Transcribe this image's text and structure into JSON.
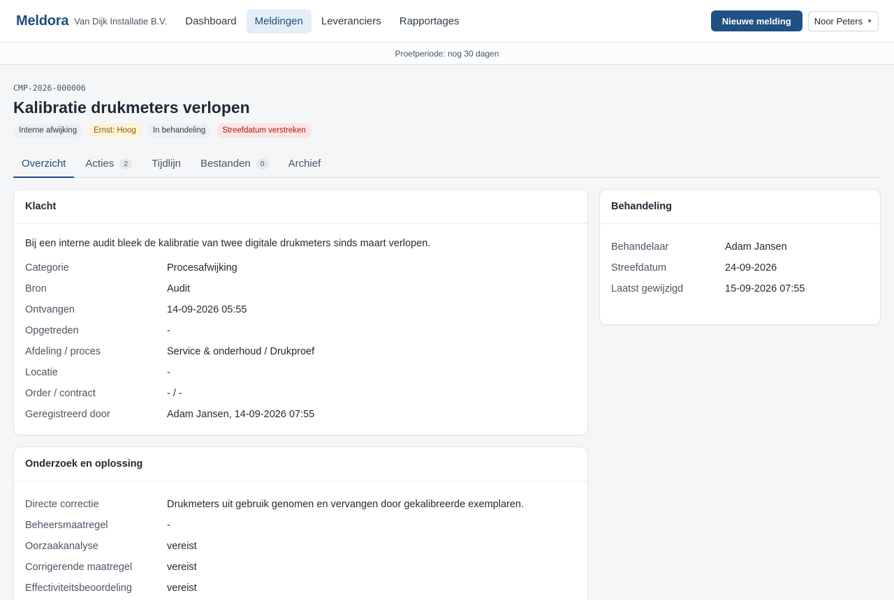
{
  "header": {
    "brand": "Meldora",
    "company": "Van Dijk Installatie B.V.",
    "nav": [
      {
        "label": "Dashboard",
        "active": false
      },
      {
        "label": "Meldingen",
        "active": true
      },
      {
        "label": "Leveranciers",
        "active": false
      },
      {
        "label": "Rapportages",
        "active": false
      }
    ],
    "new_button": "Nieuwe melding",
    "user": "Noor Peters"
  },
  "trial": "Proefperiode: nog 30 dagen",
  "complaint": {
    "reference": "CMP-2026-000006",
    "title": "Kalibratie drukmeters verlopen",
    "badges": [
      {
        "label": "Interne afwijking",
        "tone": "neutral"
      },
      {
        "label": "Ernst: Hoog",
        "tone": "warn"
      },
      {
        "label": "In behandeling",
        "tone": "neutral"
      },
      {
        "label": "Streefdatum verstreken",
        "tone": "danger"
      }
    ]
  },
  "tabs": [
    {
      "label": "Overzicht",
      "count": null,
      "active": true
    },
    {
      "label": "Acties",
      "count": "2",
      "active": false
    },
    {
      "label": "Tijdlijn",
      "count": null,
      "active": false
    },
    {
      "label": "Bestanden",
      "count": "0",
      "active": false
    },
    {
      "label": "Archief",
      "count": null,
      "active": false
    }
  ],
  "klacht": {
    "title": "Klacht",
    "description": "Bij een interne audit bleek de kalibratie van twee digitale drukmeters sinds maart verlopen.",
    "fields": [
      {
        "label": "Categorie",
        "value": "Procesafwijking"
      },
      {
        "label": "Bron",
        "value": "Audit"
      },
      {
        "label": "Ontvangen",
        "value": "14-09-2026 05:55"
      },
      {
        "label": "Opgetreden",
        "value": "-"
      },
      {
        "label": "Afdeling / proces",
        "value": "Service & onderhoud / Drukproef"
      },
      {
        "label": "Locatie",
        "value": "-"
      },
      {
        "label": "Order / contract",
        "value": "- / -"
      },
      {
        "label": "Geregistreerd door",
        "value": "Adam Jansen, 14-09-2026 07:55"
      }
    ]
  },
  "onderzoek": {
    "title": "Onderzoek en oplossing",
    "fields": [
      {
        "label": "Directe correctie",
        "value": "Drukmeters uit gebruik genomen en vervangen door gekalibreerde exemplaren."
      },
      {
        "label": "Beheersmaatregel",
        "value": "-"
      },
      {
        "label": "Oorzaakanalyse",
        "value": "vereist"
      },
      {
        "label": "Corrigerende maatregel",
        "value": "vereist"
      },
      {
        "label": "Effectiviteitsbeoordeling",
        "value": "vereist"
      }
    ]
  },
  "behandeling": {
    "title": "Behandeling",
    "fields": [
      {
        "label": "Behandelaar",
        "value": "Adam Jansen"
      },
      {
        "label": "Streefdatum",
        "value": "24-09-2026"
      },
      {
        "label": "Laatst gewijzigd",
        "value": "15-09-2026 07:55"
      }
    ]
  }
}
